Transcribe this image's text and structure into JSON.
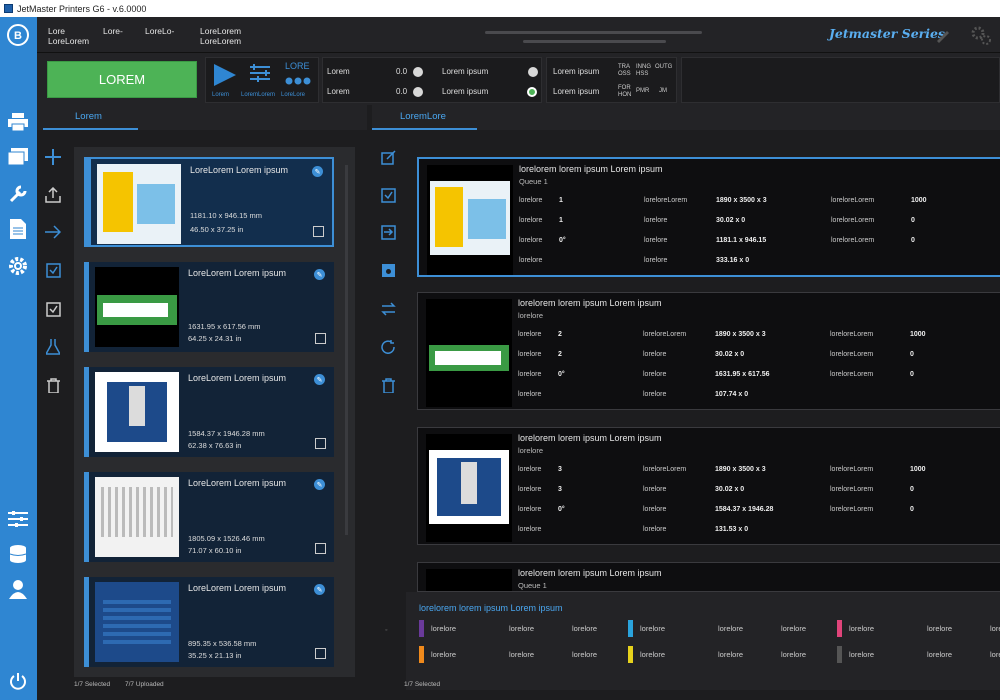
{
  "window": {
    "title": "JetMaster Printers G6 - v.6.0000"
  },
  "topbar": {
    "fields": [
      "Lore\nLoreLorem",
      "Lore-",
      "LoreLo-",
      "LoreLorem\nLoreLorem"
    ],
    "brand": "Jetmaster Series"
  },
  "control": {
    "start_label": "LOREM",
    "play_label": "Lorem",
    "align_label": "LoremLorem",
    "drops_title": "LORE",
    "drops_label": "LoreLore",
    "status": [
      {
        "label": "Lorem",
        "value": "0.0"
      },
      {
        "label": "Lorem",
        "value": "0.0"
      }
    ],
    "ipsum": [
      {
        "label": "Lorem ipsum"
      },
      {
        "label": "Lorem ipsum"
      }
    ],
    "modes": {
      "labels": [
        "Lorem ipsum",
        "Lorem ipsum"
      ],
      "codes": [
        "TRA\nOSS",
        "INNG\nHSS",
        "OUTG",
        "FOR\nHON",
        "PMR",
        "JM"
      ]
    }
  },
  "left_tab": "Lorem",
  "right_tab": "LoremLore",
  "jobs": [
    {
      "name": "LoreLorem Lorem ipsum",
      "dim_mm": "1181.10 x 946.15 mm",
      "dim_in": "46.50 x 37.25 in"
    },
    {
      "name": "LoreLorem Lorem ipsum",
      "dim_mm": "1631.95 x 617.56 mm",
      "dim_in": "64.25 x 24.31 in"
    },
    {
      "name": "LoreLorem Lorem ipsum",
      "dim_mm": "1584.37 x 1946.28 mm",
      "dim_in": "62.38 x 76.63 in"
    },
    {
      "name": "LoreLorem Lorem ipsum",
      "dim_mm": "1805.09 x 1526.46 mm",
      "dim_in": "71.07 x 60.10 in"
    },
    {
      "name": "LoreLorem Lorem ipsum",
      "dim_mm": "895.35 x 536.58 mm",
      "dim_in": "35.25 x 21.13 in"
    }
  ],
  "left_footer": {
    "selected": "1/7 Selected",
    "uploaded": "7/7 Uploaded"
  },
  "right_footer": {
    "selected": "1/7 Selected"
  },
  "queue": [
    {
      "title": "lorelorem lorem ipsum Lorem ipsum",
      "sub": "Queue 1",
      "rows": [
        [
          "lorelore",
          "1",
          "loreloreLorem",
          "1890 x 3500 x 3",
          "loreloreLorem",
          "1000"
        ],
        [
          "lorelore",
          "1",
          "lorelore",
          "30.02 x 0",
          "loreloreLorem",
          "0"
        ],
        [
          "lorelore",
          "0°",
          "lorelore",
          "1181.1 x 946.15",
          "loreloreLorem",
          "0"
        ],
        [
          "lorelore",
          "",
          "lorelore",
          "333.16 x 0",
          "",
          ""
        ]
      ]
    },
    {
      "title": "lorelorem lorem ipsum Lorem ipsum",
      "sub": "lorelore",
      "rows": [
        [
          "lorelore",
          "2",
          "loreloreLorem",
          "1890 x 3500 x 3",
          "loreloreLorem",
          "1000"
        ],
        [
          "lorelore",
          "2",
          "lorelore",
          "30.02 x 0",
          "loreloreLorem",
          "0"
        ],
        [
          "lorelore",
          "0°",
          "lorelore",
          "1631.95 x 617.56",
          "loreloreLorem",
          "0"
        ],
        [
          "lorelore",
          "",
          "lorelore",
          "107.74 x 0",
          "",
          ""
        ]
      ]
    },
    {
      "title": "lorelorem lorem ipsum Lorem ipsum",
      "sub": "lorelore",
      "rows": [
        [
          "lorelore",
          "3",
          "loreloreLorem",
          "1890 x 3500 x 3",
          "loreloreLorem",
          "1000"
        ],
        [
          "lorelore",
          "3",
          "lorelore",
          "30.02 x 0",
          "loreloreLorem",
          "0"
        ],
        [
          "lorelore",
          "0°",
          "lorelore",
          "1584.37 x 1946.28",
          "loreloreLorem",
          "0"
        ],
        [
          "lorelore",
          "",
          "lorelore",
          "131.53 x 0",
          "",
          ""
        ]
      ]
    },
    {
      "title": "lorelorem lorem ipsum Lorem ipsum",
      "sub": "Queue 1",
      "rows": []
    }
  ],
  "inks": {
    "title": "lorelorem lorem ipsum Lorem ipsum",
    "label": "lorelore",
    "colors": [
      "#6a3a9a",
      "#2aa3dc",
      "#e0447a",
      "#f08a1c",
      "#e6d21c",
      "#555555"
    ]
  }
}
